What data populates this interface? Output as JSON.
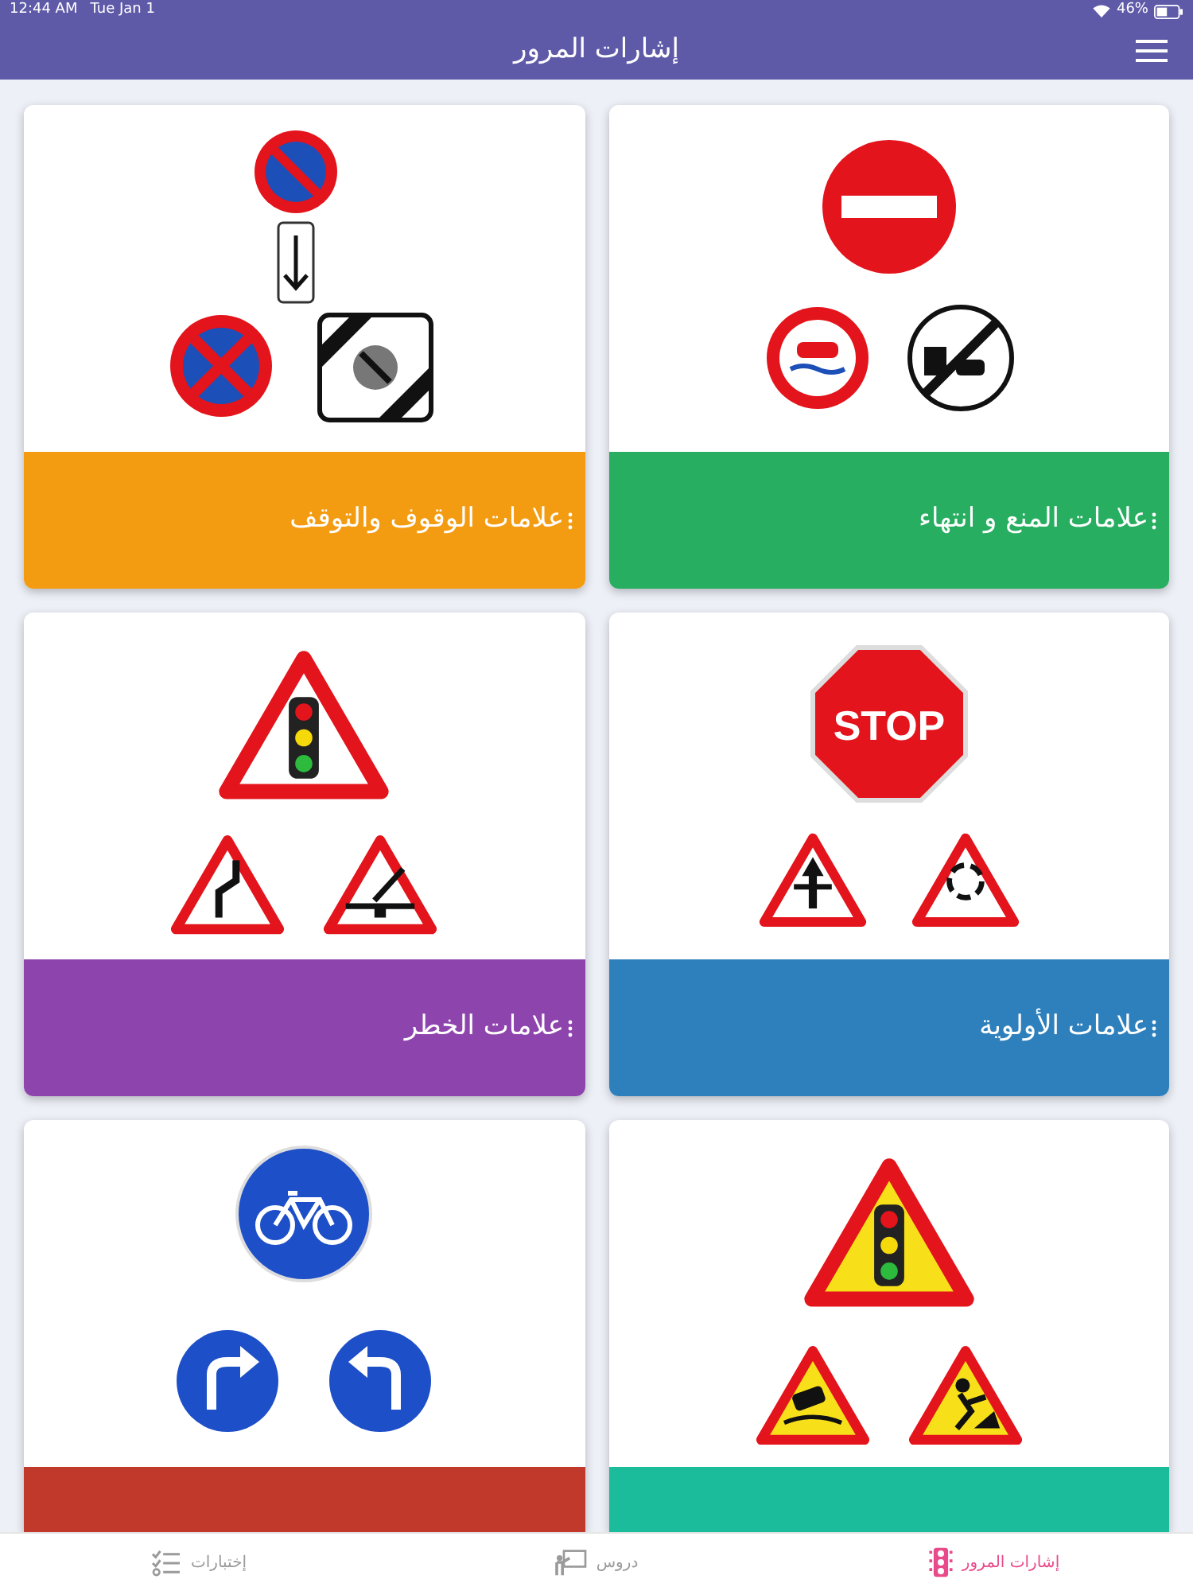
{
  "status_bar": {
    "time": "12:44 AM",
    "date": "Tue Jan 1",
    "battery": "46%"
  },
  "header": {
    "title": "إشارات المرور"
  },
  "cards": [
    {
      "title": "علامات المنع و انتهاء",
      "color": "#27ae60"
    },
    {
      "title": "علامات الوقوف والتوقف",
      "color": "#f39c12"
    },
    {
      "title": "علامات الأولوية",
      "color": "#2e80bd",
      "sign_text": "STOP"
    },
    {
      "title": "علامات الخطر",
      "color": "#8e44ad"
    },
    {
      "color": "#1abc9c"
    },
    {
      "color": "#c0392b"
    }
  ],
  "tabs": [
    {
      "label": "إشارات المرور",
      "selected": true
    },
    {
      "label": "دروس",
      "selected": false
    },
    {
      "label": "إختبارات",
      "selected": false
    }
  ]
}
